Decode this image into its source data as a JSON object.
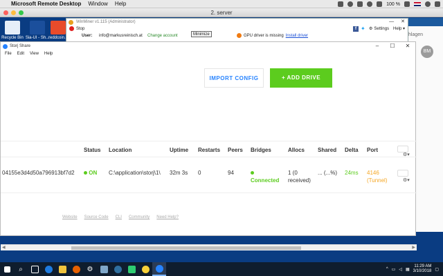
{
  "mac_menubar": {
    "app_name": "Microsoft Remote Desktop",
    "menu_items": [
      "Window",
      "Help"
    ],
    "battery": "100 %"
  },
  "rd_window": {
    "title": "2. server"
  },
  "desktop": {
    "icons": [
      {
        "label": "Recycle Bin",
        "color": "#e6eef8"
      },
      {
        "label": "Sia-UI - Sh...",
        "color": "#0b3d80"
      },
      {
        "label": "reddcoin...",
        "color": "#e84b2b"
      }
    ]
  },
  "right_window": {
    "text": "hlagen",
    "avatar": "BM"
  },
  "winminer": {
    "title": "WinMiner v1.115 (Administrator)",
    "stop_label": "Stop",
    "settings_label": "Settings",
    "help_label": "Help",
    "user_label": "User:",
    "email": "info@markusreinisch.at",
    "change_account": "Change account",
    "gpu_warning": "GPU driver is missing",
    "install_driver": "Install driver",
    "minimize_tooltip": "Minimize"
  },
  "storj": {
    "title": "Storj Share",
    "menu": [
      "File",
      "Edit",
      "View",
      "Help"
    ],
    "import_config": "IMPORT CONFIG",
    "add_drive": "+ ADD DRIVE",
    "columns": [
      "Status",
      "Location",
      "Uptime",
      "Restarts",
      "Peers",
      "Bridges",
      "Allocs",
      "Shared",
      "Delta",
      "Port"
    ],
    "row": {
      "id": "04155e3d4d50a796913bf7d2",
      "status": "ON",
      "location": "C:\\application\\storj\\1\\",
      "uptime": "32m 3s",
      "restarts": "0",
      "peers": "94",
      "bridges": "Connected",
      "allocs_line1": "1 (0",
      "allocs_line2": "received)",
      "shared": "... (...%)",
      "delta": "24ms",
      "port_line1": "4146",
      "port_line2": "(Tunnel)"
    },
    "footer_links": [
      "Website",
      "Source Code",
      "CLI",
      "Community",
      "Need Help?"
    ],
    "colors": {
      "accent_blue": "#2683ff",
      "accent_green": "#5ccc1e",
      "accent_orange": "#f5a623"
    }
  },
  "taskbar": {
    "time": "11:29 AM",
    "date": "3/10/2018"
  }
}
